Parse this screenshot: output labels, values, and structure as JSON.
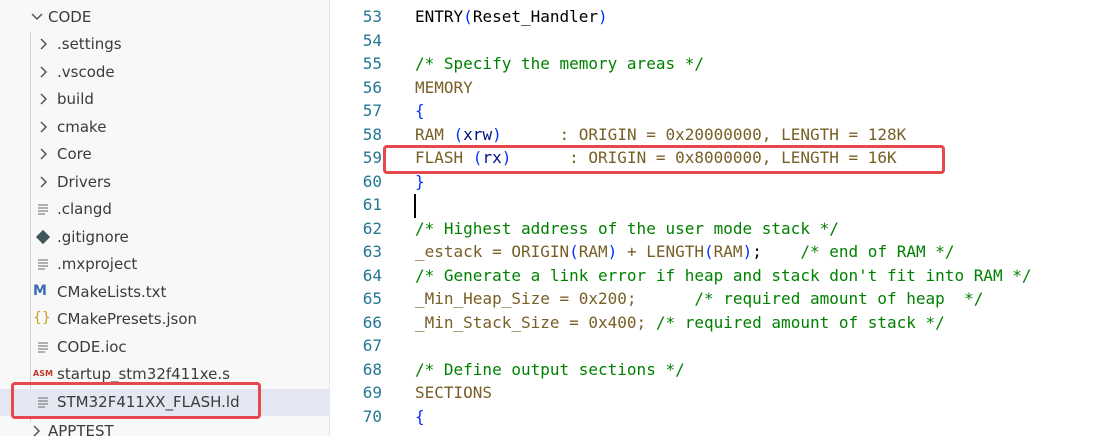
{
  "explorer": {
    "root_label": "CODE",
    "items": [
      {
        "label": ".settings",
        "kind": "folder",
        "icon": "chevron-right-icon"
      },
      {
        "label": ".vscode",
        "kind": "folder",
        "icon": "chevron-right-icon"
      },
      {
        "label": "build",
        "kind": "folder",
        "icon": "chevron-right-icon"
      },
      {
        "label": "cmake",
        "kind": "folder",
        "icon": "chevron-right-icon"
      },
      {
        "label": "Core",
        "kind": "folder",
        "icon": "chevron-right-icon"
      },
      {
        "label": "Drivers",
        "kind": "folder",
        "icon": "chevron-right-icon"
      },
      {
        "label": ".clangd",
        "kind": "file",
        "icon": "text-file-icon"
      },
      {
        "label": ".gitignore",
        "kind": "file",
        "icon": "git-icon"
      },
      {
        "label": ".mxproject",
        "kind": "file",
        "icon": "text-file-icon"
      },
      {
        "label": "CMakeLists.txt",
        "kind": "file",
        "icon": "cmake-icon",
        "icon_text": "M"
      },
      {
        "label": "CMakePresets.json",
        "kind": "file",
        "icon": "json-icon",
        "icon_text": "{}"
      },
      {
        "label": "CODE.ioc",
        "kind": "file",
        "icon": "text-file-icon"
      },
      {
        "label": "startup_stm32f411xe.s",
        "kind": "file",
        "icon": "asm-icon",
        "icon_text": "ASM"
      },
      {
        "label": "STM32F411XX_FLASH.ld",
        "kind": "file",
        "icon": "text-file-icon",
        "selected": true
      }
    ],
    "next_root_label": "APPTEST"
  },
  "editor": {
    "lines": [
      {
        "num": "53",
        "tokens": [
          [
            "ENTRY",
            "#000000"
          ],
          [
            "(",
            "#0431fa"
          ],
          [
            "Reset_Handler",
            "#000000"
          ],
          [
            ")",
            "#0431fa"
          ]
        ]
      },
      {
        "num": "54",
        "tokens": []
      },
      {
        "num": "55",
        "tokens": [
          [
            "/* Specify the memory areas */",
            "#008000"
          ]
        ]
      },
      {
        "num": "56",
        "tokens": [
          [
            "MEMORY",
            "#795e26"
          ]
        ]
      },
      {
        "num": "57",
        "tokens": [
          [
            "{",
            "#0431fa"
          ]
        ]
      },
      {
        "num": "58",
        "tokens": [
          [
            "RAM ",
            "#795e26"
          ],
          [
            "(",
            "#0431fa"
          ],
          [
            "xrw",
            "#001080"
          ],
          [
            ")",
            "#0431fa"
          ],
          [
            "      : ORIGIN = 0x20000000, LENGTH = 128K",
            "#795e26"
          ]
        ]
      },
      {
        "num": "59",
        "tokens": [
          [
            "FLASH ",
            "#795e26"
          ],
          [
            "(",
            "#0431fa"
          ],
          [
            "rx",
            "#001080"
          ],
          [
            ")",
            "#0431fa"
          ],
          [
            "      : ORIGIN = 0x8000000, LENGTH = 16K",
            "#795e26"
          ]
        ]
      },
      {
        "num": "60",
        "tokens": [
          [
            "}",
            "#0431fa"
          ]
        ]
      },
      {
        "num": "61",
        "tokens": []
      },
      {
        "num": "62",
        "tokens": [
          [
            "/* Highest address of the user mode stack */",
            "#008000"
          ]
        ]
      },
      {
        "num": "63",
        "tokens": [
          [
            "_estack = ORIGIN",
            "#795e26"
          ],
          [
            "(",
            "#0431fa"
          ],
          [
            "RAM",
            "#795e26"
          ],
          [
            ")",
            "#0431fa"
          ],
          [
            " + LENGTH",
            "#795e26"
          ],
          [
            "(",
            "#0431fa"
          ],
          [
            "RAM",
            "#795e26"
          ],
          [
            ")",
            "#0431fa"
          ],
          [
            ";    ",
            "#000000"
          ],
          [
            "/* end of RAM */",
            "#008000"
          ]
        ]
      },
      {
        "num": "64",
        "tokens": [
          [
            "/* Generate a link error if heap and stack don't fit into RAM */",
            "#008000"
          ]
        ]
      },
      {
        "num": "65",
        "tokens": [
          [
            "_Min_Heap_Size = 0x200;      ",
            "#795e26"
          ],
          [
            "/* required amount of heap  */",
            "#008000"
          ]
        ]
      },
      {
        "num": "66",
        "tokens": [
          [
            "_Min_Stack_Size = 0x400; ",
            "#795e26"
          ],
          [
            "/* required amount of stack */",
            "#008000"
          ]
        ]
      },
      {
        "num": "67",
        "tokens": []
      },
      {
        "num": "68",
        "tokens": [
          [
            "/* Define output sections */",
            "#008000"
          ]
        ]
      },
      {
        "num": "69",
        "tokens": [
          [
            "SECTIONS",
            "#795e26"
          ]
        ]
      },
      {
        "num": "70",
        "tokens": [
          [
            "{",
            "#0431fa"
          ]
        ]
      }
    ]
  },
  "colors": {
    "highlight_box": "#e5484d",
    "line_number": "#237893",
    "selection_bg": "#e4e6f1"
  }
}
